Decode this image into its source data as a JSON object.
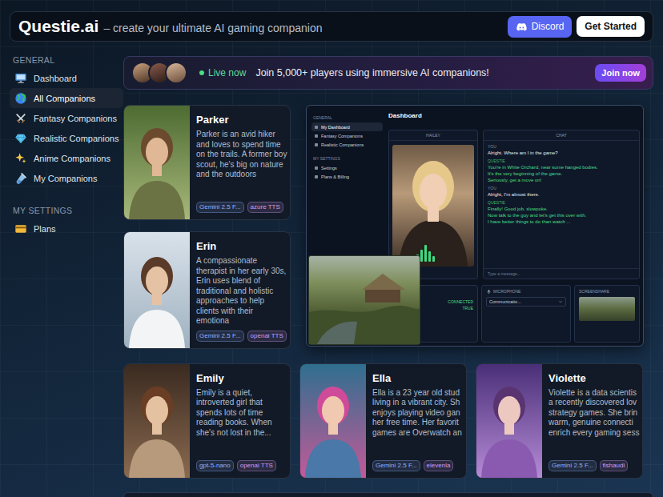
{
  "header": {
    "logo": "Questie.ai",
    "tagline": "– create your ultimate AI gaming companion",
    "buttons": [
      {
        "label": "Discord",
        "kind": "discord"
      },
      {
        "label": "Get Started",
        "kind": "primary"
      }
    ]
  },
  "sidebar": {
    "sections": [
      {
        "title": "GENERAL",
        "items": [
          {
            "label": "Dashboard",
            "selected": false
          },
          {
            "label": "All Companions",
            "selected": true
          },
          {
            "label": "Fantasy Companions",
            "selected": false
          },
          {
            "label": "Realistic Companions",
            "selected": false
          },
          {
            "label": "Anime Companions",
            "selected": false
          },
          {
            "label": "My Companions",
            "selected": false
          }
        ]
      },
      {
        "title": "MY SETTINGS",
        "items": [
          {
            "label": "Plans",
            "selected": false
          }
        ]
      }
    ]
  },
  "banner": {
    "status": "Live now",
    "text": "Join 5,000+ players using immersive AI companions!",
    "button": "Join now"
  },
  "companions": [
    {
      "name": "Parker",
      "description": "Parker is an avid hiker and loves to spend time on the trails. A former boy scout, he's big on nature and the outdoors",
      "tags": [
        {
          "label": "Gemini 2.5 F...",
          "color": "#8fb0ff"
        },
        {
          "label": "azure TTS",
          "color": "#d39cf5"
        }
      ]
    },
    {
      "name": "Erin",
      "description": "A compassionate therapist in her early 30s, Erin uses blend of traditional and holistic approaches to help clients with their emotiona",
      "tags": [
        {
          "label": "Gemini 2.5 F...",
          "color": "#8fb0ff"
        },
        {
          "label": "openai TTS",
          "color": "#d39cf5"
        }
      ]
    },
    {
      "name": "Emily",
      "description": "Emily is a quiet, introverted girl that spends lots of time reading books. When she's not lost in the...",
      "tags": [
        {
          "label": "gpt-5-nano",
          "color": "#8fb0ff"
        },
        {
          "label": "openai TTS",
          "color": "#d39cf5"
        }
      ]
    },
    {
      "name": "Ella",
      "description": "Ella is a 23 year old stud living in a vibrant city. Sh enjoys playing video gan her free time. Her favorit games are Overwatch an",
      "tags": [
        {
          "label": "Gemini 2.5 F...",
          "color": "#8fb0ff"
        },
        {
          "label": "elevenla",
          "color": "#d39cf5"
        }
      ]
    },
    {
      "name": "Violette",
      "description": "Violette is a data scientis a recently discovered lov strategy games. She brin warm, genuine connecti enrich every gaming sess",
      "tags": [
        {
          "label": "Gemini 2.5 F...",
          "color": "#8fb0ff"
        },
        {
          "label": "fishaudi",
          "color": "#d39cf5"
        }
      ]
    }
  ],
  "preview": {
    "sidebar": {
      "sections": [
        {
          "title": "GENERAL",
          "items": [
            {
              "label": "My Dashboard",
              "selected": true
            },
            {
              "label": "Fantasy Companions",
              "selected": false
            },
            {
              "label": "Realistic Companions",
              "selected": false
            }
          ]
        },
        {
          "title": "MY SETTINGS",
          "items": [
            {
              "label": "Settings",
              "selected": false
            },
            {
              "label": "Plans & Billing",
              "selected": false
            }
          ]
        }
      ]
    },
    "title": "Dashboard",
    "character_panel": {
      "title": "HAILEY"
    },
    "chat": {
      "title": "CHAT",
      "messages": [
        {
          "speaker": "YOU",
          "kind": "user",
          "lines": [
            "Alright. Where am I in the game?"
          ]
        },
        {
          "speaker": "QUESTIE",
          "kind": "bot",
          "lines": [
            "You're in White Orchard, near some hanged bodies.",
            "It's the very beginning of the game.",
            "Seriously, get a move on!"
          ]
        },
        {
          "speaker": "YOU",
          "kind": "user",
          "lines": [
            "Alright, I'm almost there."
          ]
        },
        {
          "speaker": "QUESTIE",
          "kind": "bot",
          "lines": [
            "Finally! Good job, slowpoke.",
            "Now talk to the guy and let's get this over with.",
            "I have better things to do than watch ..."
          ]
        }
      ],
      "input_placeholder": "Type a message..."
    },
    "connection": {
      "label": "CONNECTED",
      "value": "TRUE"
    },
    "microphone": {
      "label": "MICROPHONE",
      "device": "Communicatio..."
    },
    "screenshare": {
      "label": "SCREENSHARE"
    }
  }
}
